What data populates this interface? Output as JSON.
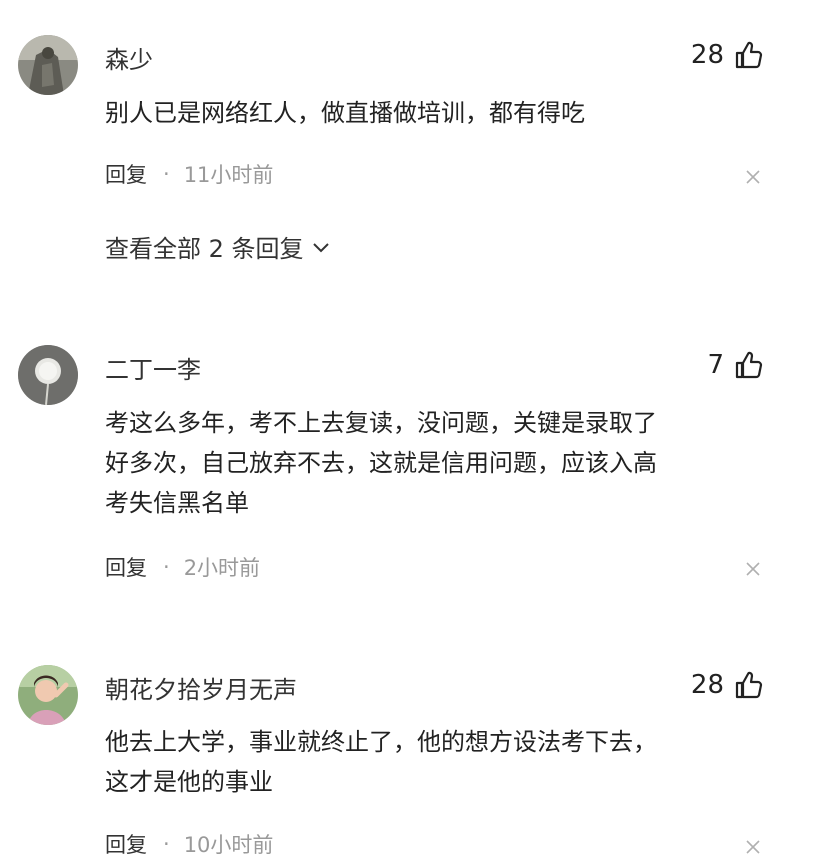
{
  "comments": [
    {
      "username": "森少",
      "likes": "28",
      "text": "别人已是网络红人，做直播做培训，都有得吃",
      "reply_label": "回复",
      "separator": "·",
      "time": "11小时前",
      "expand_label": "查看全部 2 条回复"
    },
    {
      "username": "二丁一李",
      "likes": "7",
      "text_lines": [
        "考这么多年，考不上去复读，没问题，关键是录取了",
        "好多次，自己放弃不去，这就是信用问题，应该入高",
        "考失信黑名单"
      ],
      "reply_label": "回复",
      "separator": "·",
      "time": "2小时前"
    },
    {
      "username": "朝花夕拾岁月无声",
      "likes": "28",
      "text_lines": [
        "他去上大学，事业就终止了，他的想方设法考下去，",
        "这才是他的事业"
      ],
      "reply_label": "回复",
      "separator": "·",
      "time": "10小时前"
    }
  ],
  "icons": {
    "like": "thumbs-up-icon",
    "close": "close-icon",
    "expand": "chevron-down-icon"
  }
}
